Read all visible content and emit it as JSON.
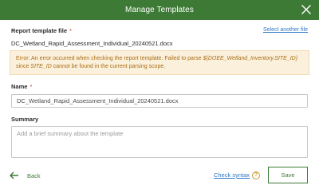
{
  "header": {
    "title": "Manage Templates",
    "close_icon": "close-icon"
  },
  "report_template": {
    "label": "Report template file",
    "required_mark": "*",
    "select_another_label": "Select another file",
    "filename": "DC_Wetland_Rapid_Assessment_Individual_20240521.docx"
  },
  "error": {
    "prefix": "Error: An error occurred when checking the report template. Failed to parse ",
    "expression": "${DOEE_Wetland_Inventory.SITE_ID}",
    "middle": " since ",
    "field": "SITE_ID",
    "suffix": " cannot be found in the current parsing scope."
  },
  "name_field": {
    "label": "Name",
    "required_mark": "*",
    "value": "DC_Wetland_Rapid_Assessment_Individual_20240521.docx"
  },
  "summary_field": {
    "label": "Summary",
    "placeholder": "Add a brief summary about the template",
    "value": ""
  },
  "footer": {
    "back_label": "Back",
    "back_icon": "arrow-left-icon",
    "check_syntax_label": "Check syntax",
    "help_icon": "question-circle-icon",
    "help_glyph": "?",
    "save_label": "Save"
  },
  "colors": {
    "header_bg": "#3d7a35",
    "link": "#2f76c7",
    "error_bg": "#fbf0dc",
    "error_text": "#a86e14",
    "required": "#d83020"
  }
}
